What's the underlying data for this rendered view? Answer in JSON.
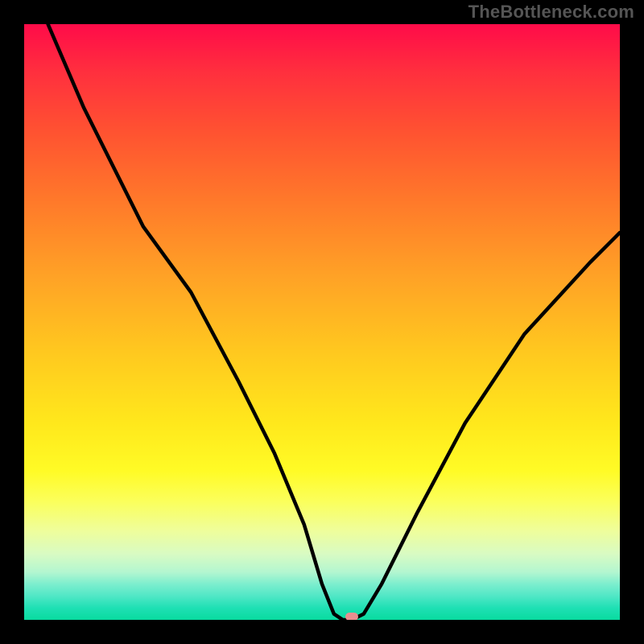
{
  "watermark": "TheBottleneck.com",
  "colors": {
    "page_bg": "#000000",
    "watermark": "#555555",
    "curve_stroke": "#000000",
    "marker": "#e98e8f",
    "gradient_top": "#ff0b49",
    "gradient_bottom": "#09db9f"
  },
  "chart_data": {
    "type": "line",
    "title": "",
    "xlabel": "",
    "ylabel": "",
    "xlim": [
      0,
      100
    ],
    "ylim": [
      0,
      100
    ],
    "grid": false,
    "legend": false,
    "series": [
      {
        "name": "bottleneck-curve",
        "x": [
          4,
          10,
          20,
          28,
          36,
          42,
          47,
          50,
          52,
          53.5,
          55,
          57,
          60,
          66,
          74,
          84,
          95,
          100
        ],
        "y": [
          100,
          86,
          66,
          55,
          40,
          28,
          16,
          6,
          1,
          0,
          0,
          1,
          6,
          18,
          33,
          48,
          60,
          65
        ]
      }
    ],
    "marker": {
      "x": 55,
      "y": 0.5
    },
    "note": "Values estimated from pixel positions relative to the gradient plot area; y is percent of plot height from bottom."
  }
}
